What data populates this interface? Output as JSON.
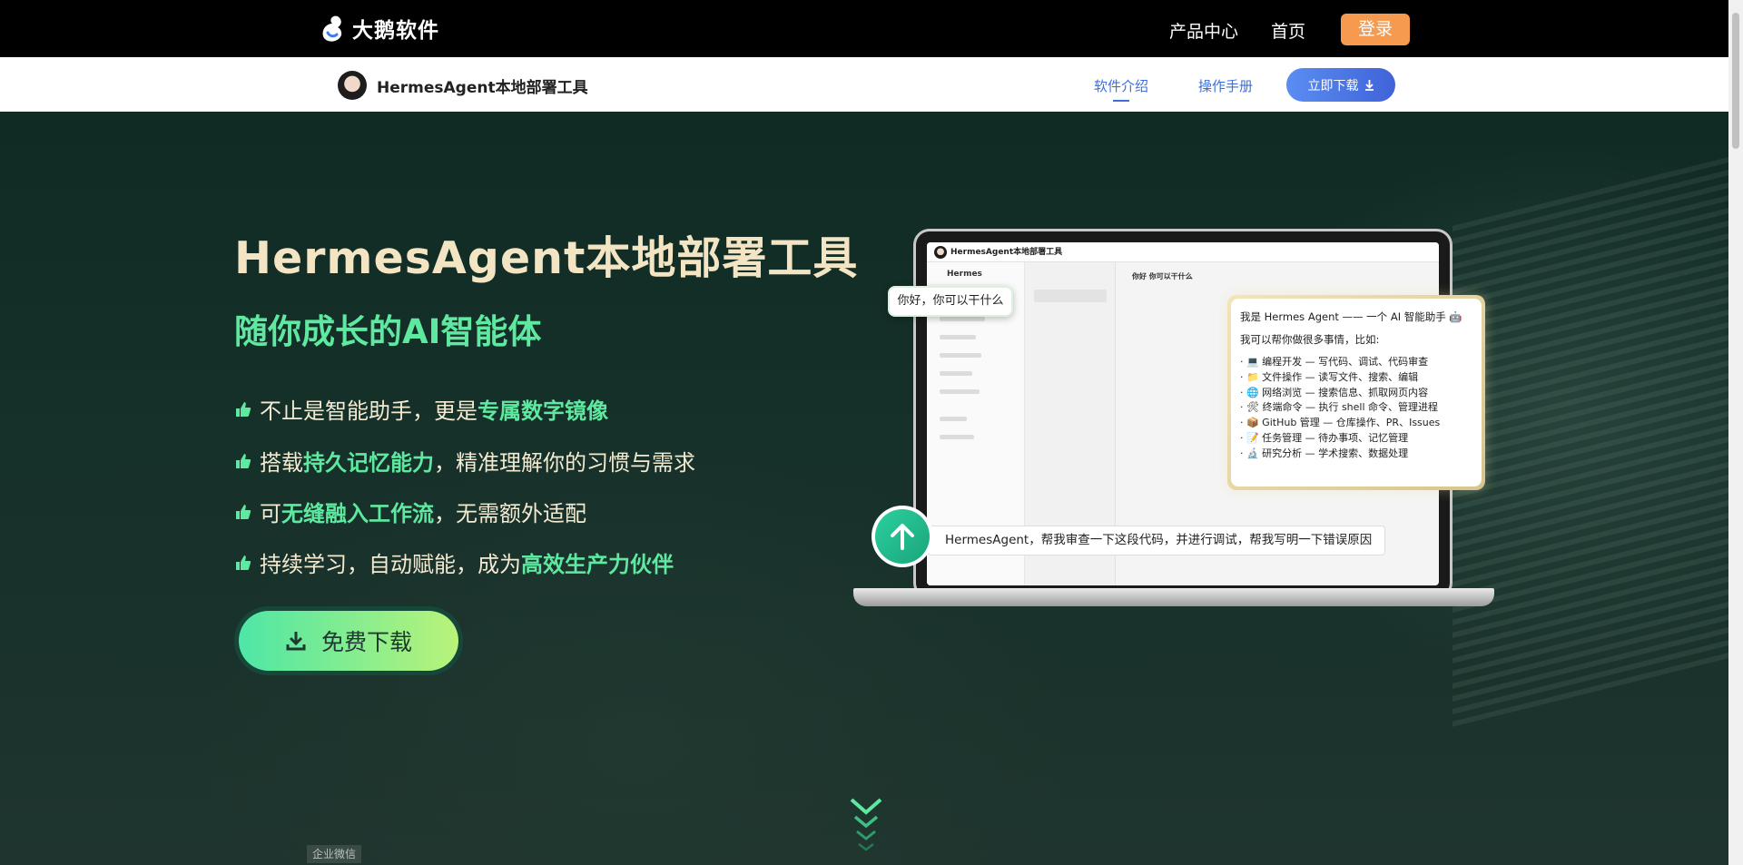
{
  "topbar": {
    "brand": "大鹅软件",
    "nav": [
      "产品中心",
      "首页"
    ],
    "login": "登录"
  },
  "subbar": {
    "app_title": "HermesAgent本地部署工具",
    "nav": [
      "软件介绍",
      "操作手册"
    ],
    "download": "立即下载"
  },
  "hero": {
    "title": "HermesAgent本地部署工具",
    "subtitle": "随你成长的AI智能体",
    "features": [
      {
        "pre": "不止是智能助手，更是",
        "hl": "专属数字镜像",
        "post": ""
      },
      {
        "pre": "搭载",
        "hl": "持久记忆能力",
        "post": "，精准理解你的习惯与需求"
      },
      {
        "pre": "可",
        "hl": "无缝融入工作流",
        "post": "，无需额外适配"
      },
      {
        "pre": "持续学习，自动赋能，成为",
        "hl": "高效生产力伙伴",
        "post": ""
      }
    ],
    "free_download": "免费下载",
    "wechat": "企业微信"
  },
  "mockup": {
    "window_title": "HermesAgent本地部署工具",
    "side_title": "Hermes",
    "chat_title": "你好 你可以干什么",
    "user_bubble": "你好，你可以干什么",
    "reply_head": "我是 Hermes Agent —— 一个 AI 智能助手 🤖",
    "reply_sub": "我可以帮你做很多事情，比如:",
    "reply_items": [
      "· 💻 编程开发 — 写代码、调试、代码审查",
      "· 📁 文件操作 — 读写文件、搜索、编辑",
      "· 🌐 网络浏览 — 搜索信息、抓取网页内容",
      "· 🛠 终端命令 — 执行 shell 命令、管理进程",
      "· 📦 GitHub 管理 — 仓库操作、PR、Issues",
      "· 📝 任务管理 — 待办事项、记忆管理",
      "· 🔬 研究分析 — 学术搜索、数据处理"
    ],
    "prompt": "HermesAgent，帮我审查一下这段代码，并进行调试，帮我写明一下错误原因"
  },
  "colors": {
    "accent_green": "#5ee8a0",
    "title_cream": "#f3e5c3",
    "login_orange": "#f59a4e",
    "link_blue": "#3d6fd8"
  }
}
